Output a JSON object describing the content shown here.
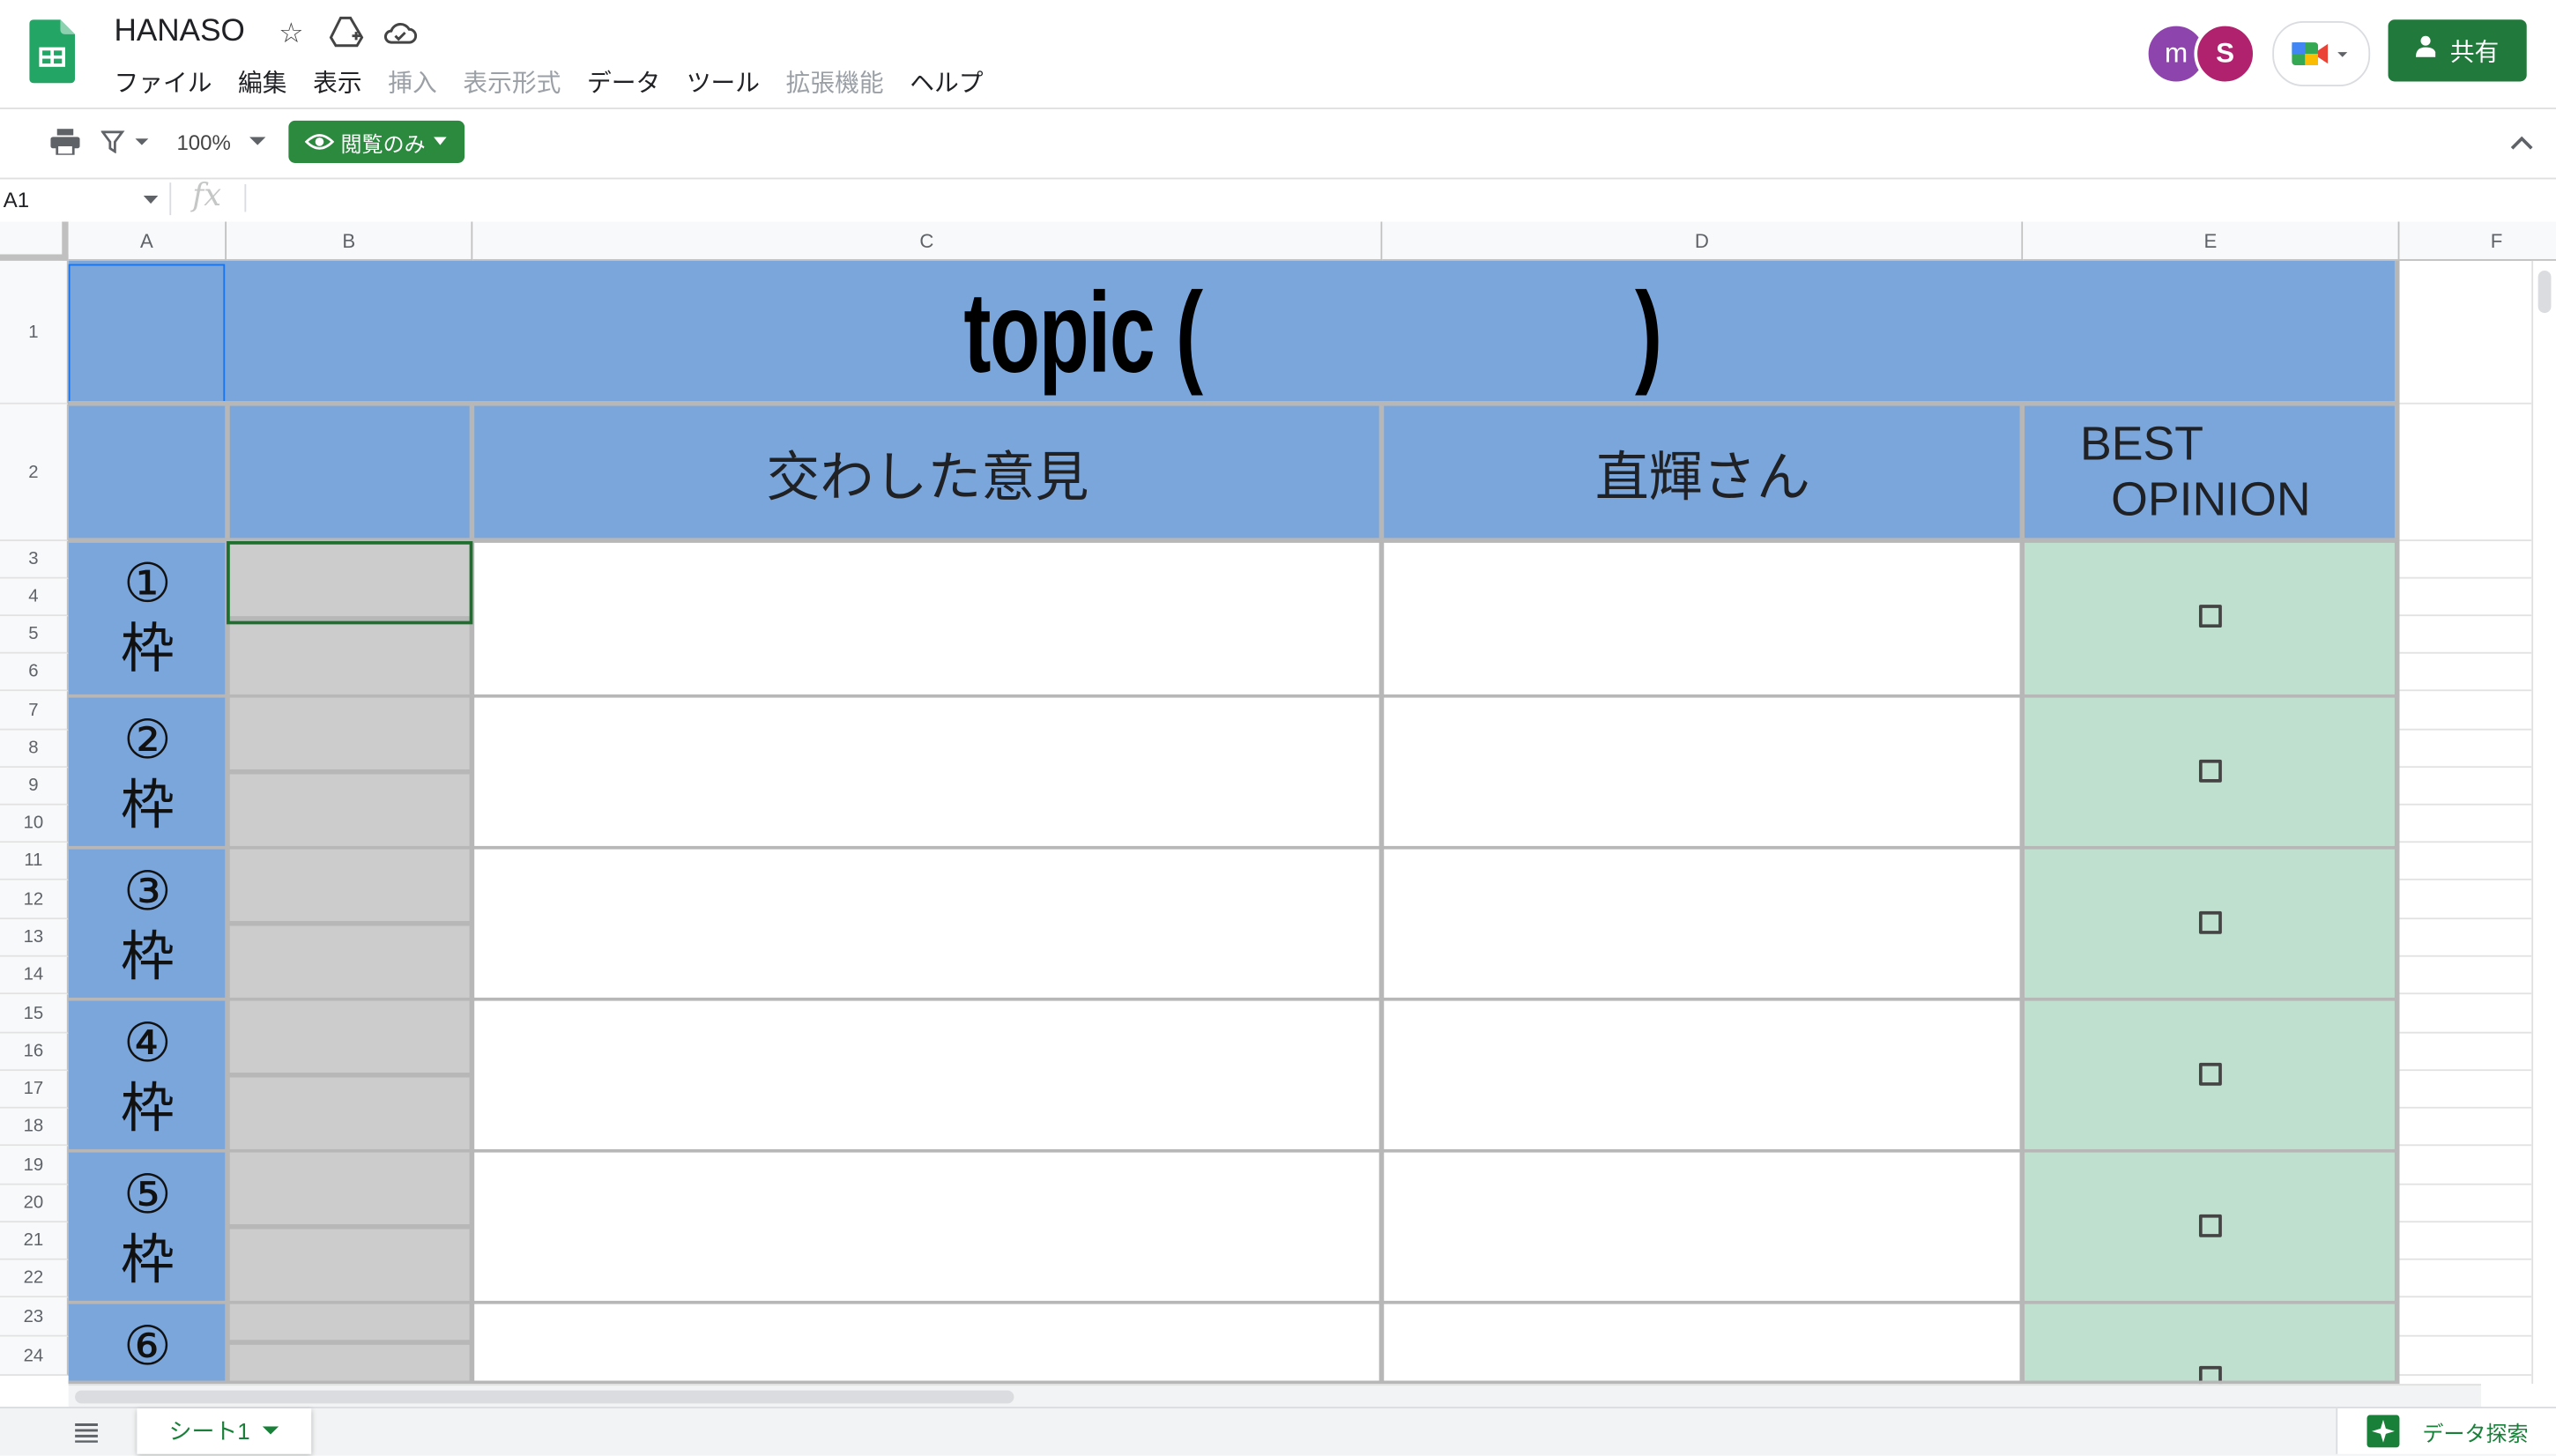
{
  "window": {
    "title": "HANASO"
  },
  "menu": [
    "ファイル",
    "編集",
    "表示",
    "挿入",
    "表示形式",
    "データ",
    "ツール",
    "拡張機能",
    "ヘルプ"
  ],
  "avatars": [
    "m",
    "S"
  ],
  "share_label": "共有",
  "toolbar": {
    "zoom": "100%",
    "view_only": "閲覧のみ"
  },
  "formula": {
    "name_box": "A1",
    "fx": "fx",
    "value": ""
  },
  "columns": [
    "A",
    "B",
    "C",
    "D",
    "E",
    "F"
  ],
  "rows": [
    "1",
    "2",
    "3",
    "4",
    "5",
    "6",
    "7",
    "8",
    "9",
    "10",
    "11",
    "12",
    "13",
    "14",
    "15",
    "16",
    "17",
    "18",
    "19",
    "20",
    "21",
    "22",
    "23",
    "24"
  ],
  "sheet": {
    "title": "topic (                    )",
    "headers": {
      "opinion": "交わした意見",
      "person": "直輝さん",
      "best_line1": "BEST",
      "best_line2": "OPINION"
    },
    "groups": [
      {
        "num": "①",
        "waku": "枠"
      },
      {
        "num": "②",
        "waku": "枠"
      },
      {
        "num": "③",
        "waku": "枠"
      },
      {
        "num": "④",
        "waku": "枠"
      },
      {
        "num": "⑤",
        "waku": "枠"
      },
      {
        "num": "⑥",
        "waku": ""
      }
    ]
  },
  "tabs": [
    {
      "label": "シート1",
      "active": true
    }
  ],
  "explore_label": "データ探索",
  "colors": {
    "header_blue": "#7aa6db",
    "gray_cell": "#cccccc",
    "best_green": "#c0e0cf",
    "brand_green": "#188038"
  }
}
